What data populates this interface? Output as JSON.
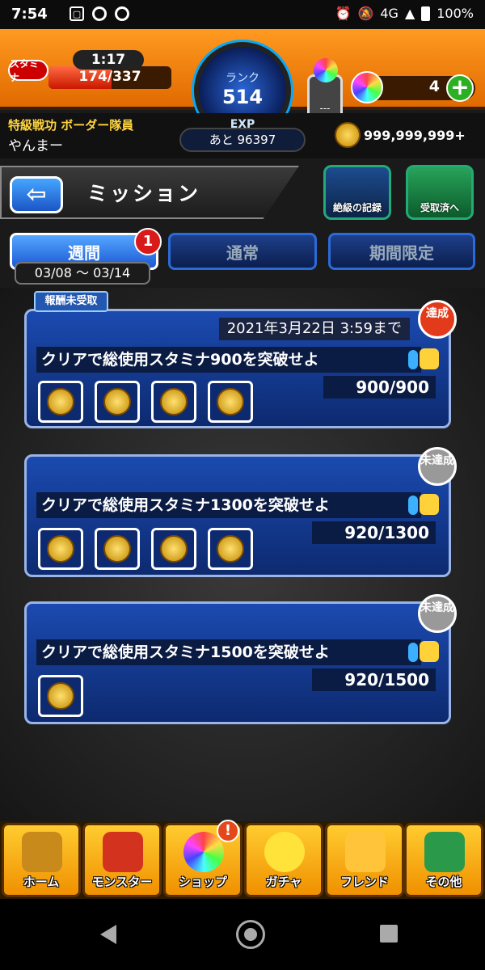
{
  "status": {
    "time": "7:54",
    "network": "4G",
    "battery": "100%"
  },
  "header": {
    "stamina_label": "スタミナ",
    "stamina_timer": "1:17",
    "stamina_value": "174/337",
    "stamina_fill": 0.516,
    "rank_label": "ランク",
    "rank_value": "514",
    "exp_label": "EXP",
    "exp_remaining": "あと 96397",
    "gem_slot": "---",
    "orb_count": "4",
    "title": "特級戦功 ボーダー隊員",
    "username": "やんまー",
    "coins": "999,999,999+"
  },
  "nav": {
    "back_icon": "left-arrow-icon",
    "page_title": "ミッション",
    "record_label": "絶級の記録",
    "claimed_label": "受取済へ"
  },
  "tabs": [
    {
      "label": "週間",
      "active": true,
      "dates": "03/08 ～ 03/14",
      "badge": "1"
    },
    {
      "label": "通常",
      "active": false
    },
    {
      "label": "期間限定",
      "active": false
    }
  ],
  "missions": {
    "unclaimed_tag": "報酬未受取",
    "items": [
      {
        "deadline": "2021年3月22日 3:59まで",
        "text": "クリアで総使用スタミナ900を突破せよ",
        "progress": "900/900",
        "status": "達成",
        "reward_count": 4
      },
      {
        "text": "クリアで総使用スタミナ1300を突破せよ",
        "progress": "920/1300",
        "status": "未達成",
        "reward_count": 4
      },
      {
        "text": "クリアで総使用スタミナ1500を突破せよ",
        "progress": "920/1500",
        "status": "未達成",
        "reward_count": 1
      }
    ]
  },
  "bottom_nav": [
    {
      "label": "ホーム",
      "icon": "home-icon"
    },
    {
      "label": "モンスター",
      "icon": "monster-icon"
    },
    {
      "label": "ショップ",
      "icon": "shop-orb-icon",
      "alert": "!"
    },
    {
      "label": "ガチャ",
      "icon": "gacha-egg-icon"
    },
    {
      "label": "フレンド",
      "icon": "friend-icon"
    },
    {
      "label": "その他",
      "icon": "other-icon"
    }
  ],
  "colors": {
    "header_orange": "#ff9a20",
    "card_blue": "#1b4ab0",
    "active_tab": "#54a6ff",
    "achieved": "#e23a1a",
    "nav_gold": "#ffcc30"
  }
}
